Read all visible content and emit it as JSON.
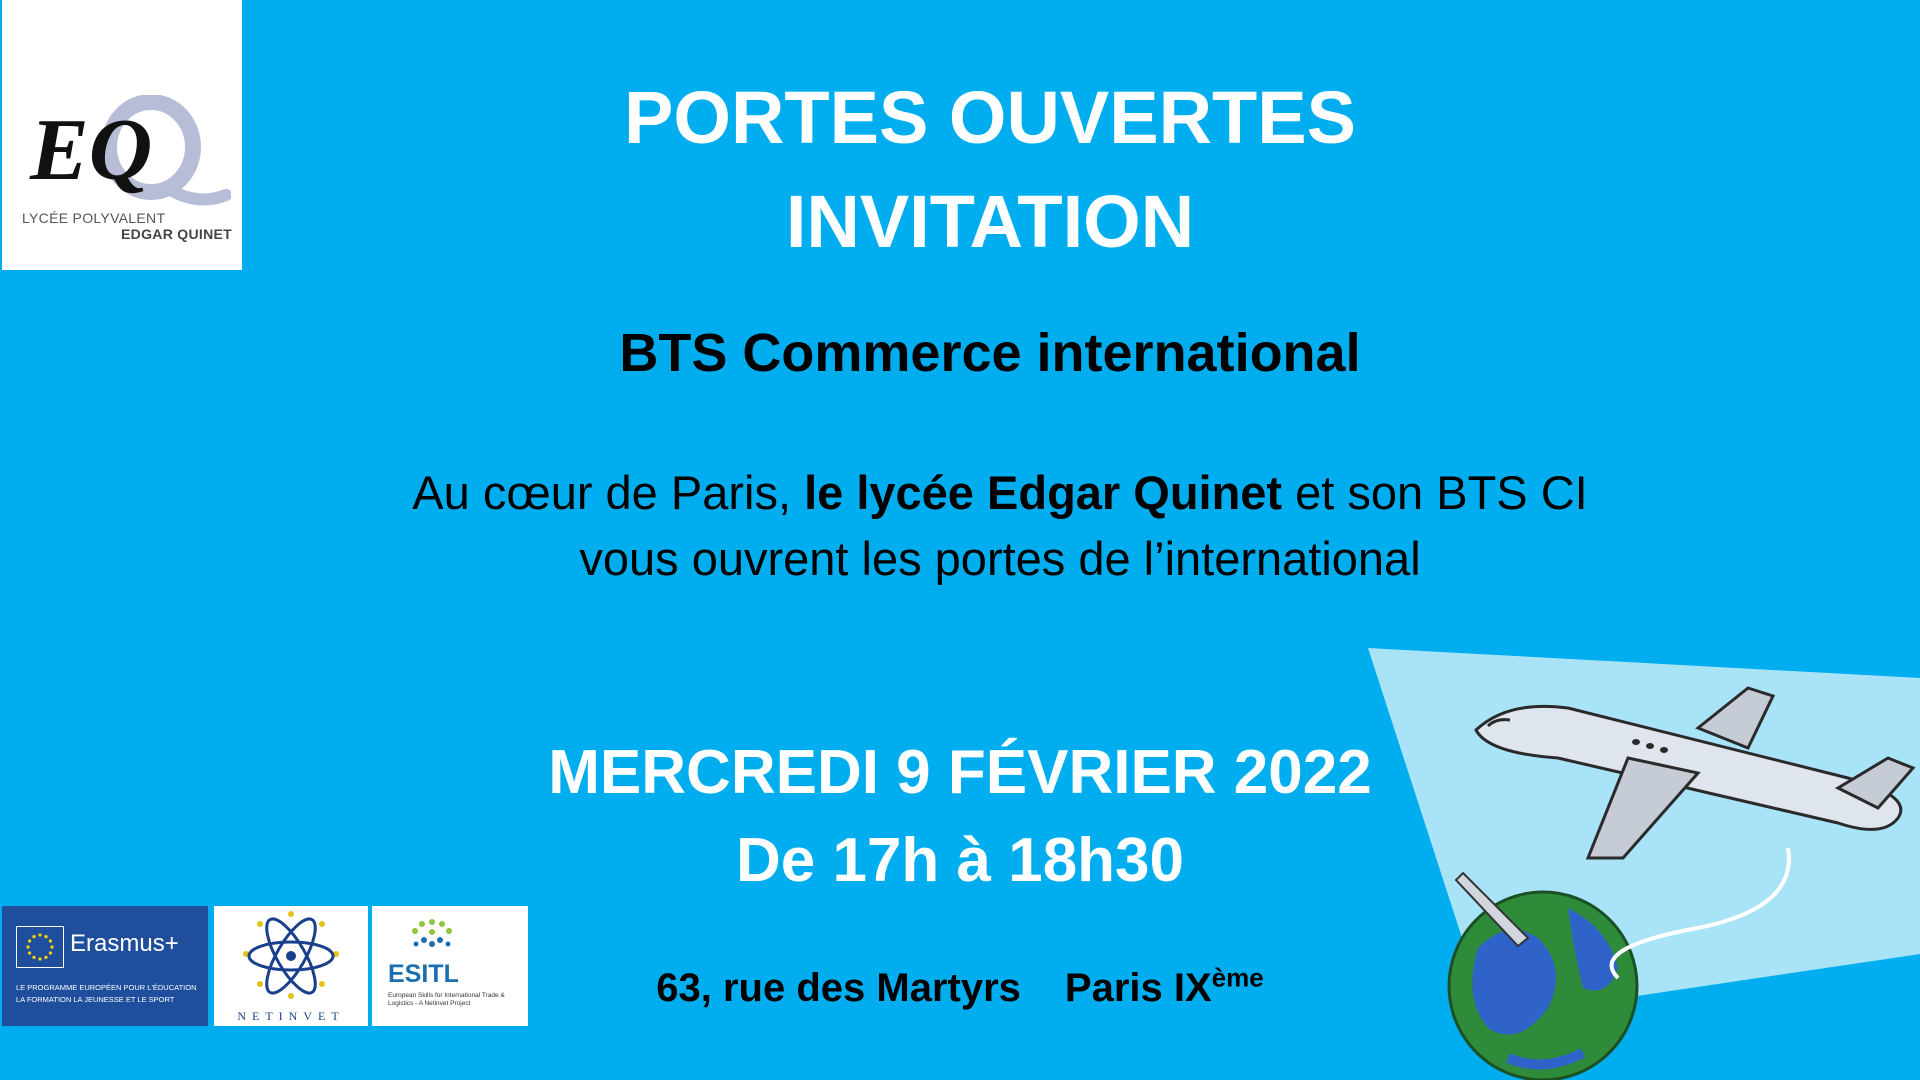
{
  "logo": {
    "mark": "EQ",
    "line1": "LYCÉE POLYVALENT",
    "line2": "EDGAR QUINET"
  },
  "title": {
    "line1": "PORTES OUVERTES",
    "line2": "INVITATION"
  },
  "subtitle": "BTS Commerce international",
  "intro": {
    "line1_before": "Au cœur de Paris, ",
    "line1_bold": "le lycée Edgar Quinet",
    "line1_after": " et son BTS CI",
    "line2": "vous ouvrent les portes de l’international"
  },
  "event": {
    "date": "MERCREDI 9 FÉVRIER 2022",
    "time": "De 17h à 18h30"
  },
  "address": {
    "street": "63, rue des Martyrs",
    "city": "Paris IX",
    "city_sup": "ème"
  },
  "partners": {
    "erasmus": {
      "name": "Erasmus+",
      "tagline": "LE PROGRAMME EUROPÉEN POUR L'ÉDUCATION LA FORMATION LA JEUNESSE ET LE SPORT"
    },
    "netinvet": {
      "name": "NETINVET"
    },
    "esitl": {
      "name": "ESITL",
      "tagline": "European Skills for International Trade & Logistics - A Netinvet Project"
    }
  },
  "colors": {
    "background": "#00aeef",
    "title": "#ffffff",
    "body_text": "#000000",
    "erasmus_blue": "#1f4f9c"
  },
  "icons": {
    "clipart": "airplane-globe-illustration"
  }
}
